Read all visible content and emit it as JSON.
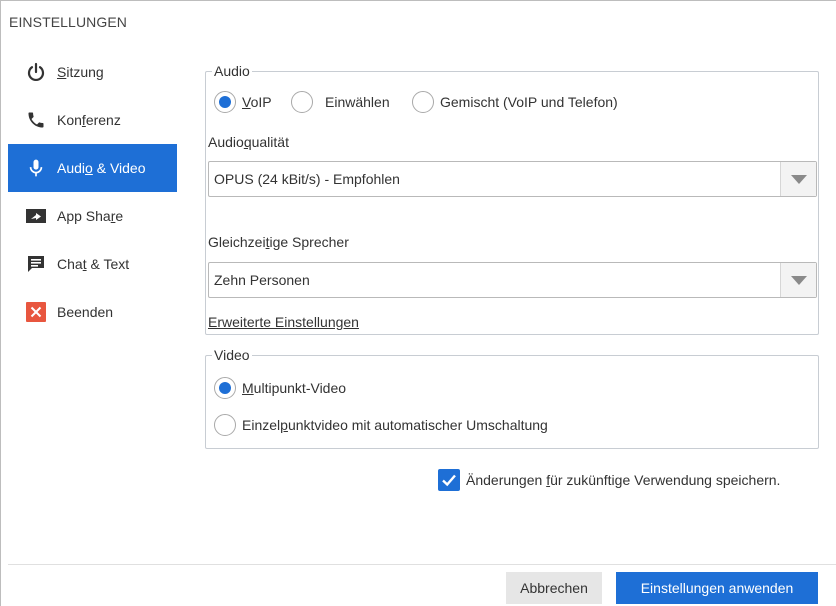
{
  "dialog": {
    "title": "EINSTELLUNGEN"
  },
  "sidebar": {
    "items": [
      {
        "label_u": "S",
        "label_rest": "itzung",
        "icon": "power-icon",
        "active": false
      },
      {
        "label_pre": "Kon",
        "label_u": "f",
        "label_rest": "erenz",
        "icon": "phone-icon",
        "active": false
      },
      {
        "label_pre": "Audi",
        "label_u": "o",
        "label_rest": " & Video",
        "icon": "microphone-icon",
        "active": true
      },
      {
        "label_pre": "App Sha",
        "label_u": "r",
        "label_rest": "e",
        "icon": "screen-share-icon",
        "active": false
      },
      {
        "label_pre": "Cha",
        "label_u": "t",
        "label_rest": " & Text",
        "icon": "chat-icon",
        "active": false
      },
      {
        "label": "Beenden",
        "icon": "close-icon",
        "active": false
      }
    ]
  },
  "audio": {
    "legend": "Audio",
    "options": [
      {
        "label_u": "V",
        "label_rest": "oIP",
        "selected": true
      },
      {
        "label": "Einwählen",
        "selected": false
      },
      {
        "label": "Gemischt (VoIP und Telefon)",
        "selected": false
      }
    ],
    "quality_label_pre": "Audio",
    "quality_label_u": "q",
    "quality_label_rest": "ualität",
    "quality_value": "OPUS (24 kBit/s) - Empfohlen",
    "speakers_label_pre": "Gleichzei",
    "speakers_label_u": "t",
    "speakers_label_rest": "ige Sprecher",
    "speakers_value": "Zehn Personen",
    "advanced_link": "Erweiterte Einstellungen"
  },
  "video": {
    "legend": "Video",
    "options": [
      {
        "label_u": "M",
        "label_rest": "ultipunkt-Video",
        "selected": true
      },
      {
        "label_pre": "Einzel",
        "label_u": "p",
        "label_rest": "unktvideo mit automatischer Umschaltung",
        "selected": false
      }
    ]
  },
  "save_checkbox": {
    "label_pre": "Änderungen ",
    "label_u": "f",
    "label_rest": "ür zukünftige Verwendung speichern.",
    "checked": true
  },
  "buttons": {
    "cancel": "Abbrechen",
    "apply": "Einstellungen anwenden"
  },
  "colors": {
    "accent": "#1e6fd6",
    "close_red": "#e8563f"
  }
}
